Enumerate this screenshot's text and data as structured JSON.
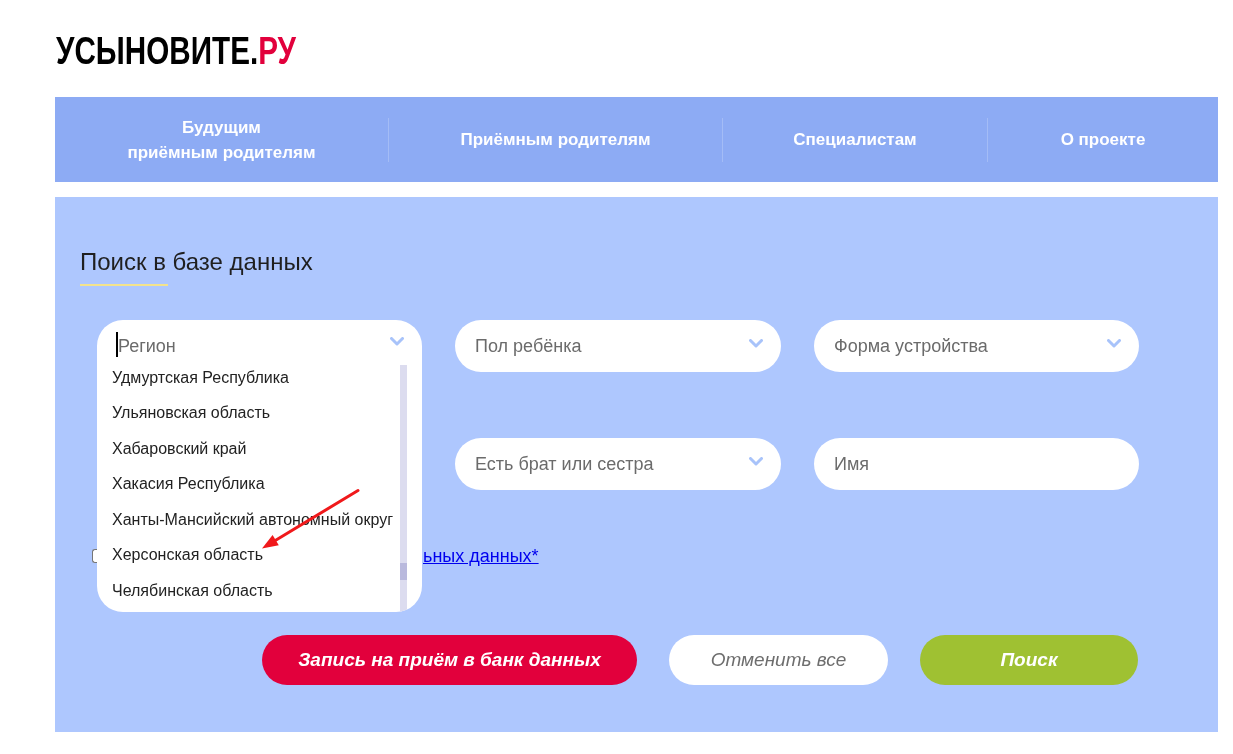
{
  "logo": {
    "text": "УСЫНОВИТЕ.",
    "accent": "РУ"
  },
  "nav": [
    {
      "label": "Будущим\nприёмным родителям"
    },
    {
      "label": "Приёмным родителям"
    },
    {
      "label": "Специалистам"
    },
    {
      "label": "О проекте"
    }
  ],
  "search": {
    "title": "Поиск в базе данных",
    "rows": [
      [
        {
          "kind": "combobox",
          "placeholder": "Регион",
          "focused": true,
          "expanded": true,
          "options": [
            {
              "label": "Удмуртская Республика",
              "annotated": false
            },
            {
              "label": "Ульяновская область",
              "annotated": false
            },
            {
              "label": "Хабаровский край",
              "annotated": false
            },
            {
              "label": "Хакасия Республика",
              "annotated": false
            },
            {
              "label": "Ханты-Мансийский автономный округ",
              "annotated": false
            },
            {
              "label": "Херсонская область",
              "annotated": true
            },
            {
              "label": "Челябинская область",
              "annotated": false
            }
          ]
        },
        {
          "kind": "select",
          "placeholder": "Пол ребёнка"
        },
        {
          "kind": "select",
          "placeholder": "Форма устройства"
        }
      ],
      [
        "",
        {
          "kind": "select",
          "placeholder": "Есть брат или сестра"
        },
        {
          "kind": "input",
          "placeholder": "Имя"
        }
      ]
    ],
    "consent": {
      "checked": false,
      "link": "ьных данных*"
    },
    "buttons": [
      {
        "kind": "primary",
        "label": "Запись на приём в банк данных"
      },
      {
        "kind": "secondary",
        "label": "Отменить все"
      },
      {
        "kind": "accent",
        "label": "Поиск"
      }
    ]
  }
}
